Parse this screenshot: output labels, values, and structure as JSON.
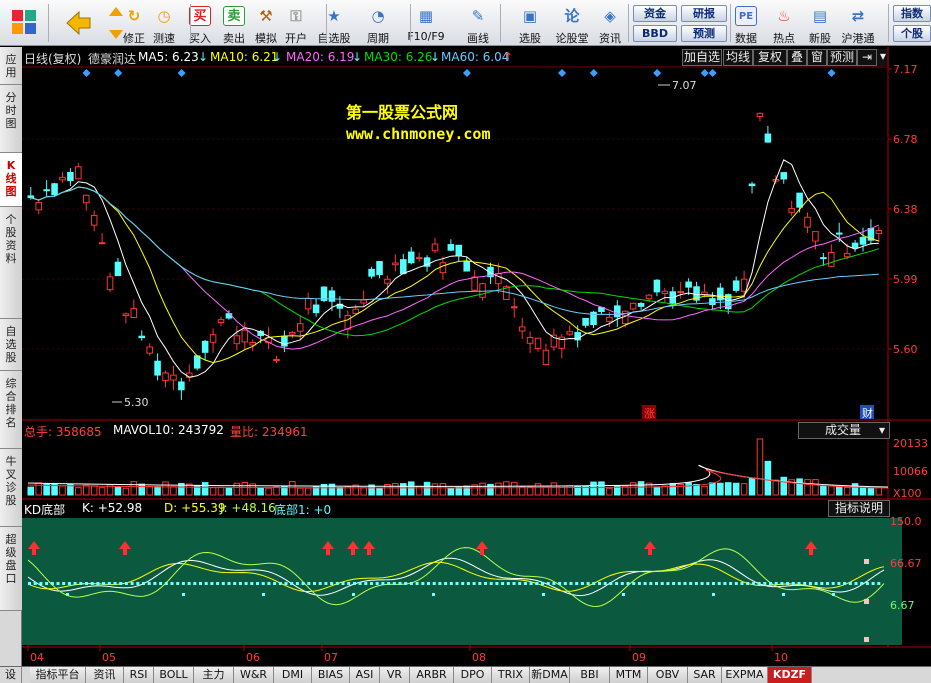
{
  "toolbar": {
    "items": [
      {
        "label": "修正",
        "icon": "refresh-icon"
      },
      {
        "label": "测速",
        "icon": "clock-icon"
      },
      {
        "label": "买入",
        "icon": "buy-icon",
        "glyph": "买"
      },
      {
        "label": "卖出",
        "icon": "sell-icon",
        "glyph": "卖"
      },
      {
        "label": "模拟",
        "icon": "hammer-icon"
      },
      {
        "label": "开户",
        "icon": "lock-icon"
      },
      {
        "label": "自选股",
        "icon": "star-icon"
      },
      {
        "label": "周期",
        "icon": "period-icon"
      },
      {
        "label": "F10/F9",
        "icon": "f10-icon"
      },
      {
        "label": "画线",
        "icon": "pencil-icon"
      },
      {
        "label": "选股",
        "icon": "select-stock-icon"
      },
      {
        "label": "论股堂",
        "icon": "forum-icon",
        "glyph": "论"
      },
      {
        "label": "资讯",
        "icon": "news-icon"
      },
      {
        "label": "数据",
        "icon": "data-icon",
        "glyph": "PE"
      },
      {
        "label": "热点",
        "icon": "hot-icon"
      },
      {
        "label": "新股",
        "icon": "new-stock-icon"
      },
      {
        "label": "沪港通",
        "icon": "shhk-icon"
      }
    ],
    "pills": [
      "资金",
      "研报",
      "BBD",
      "预测"
    ],
    "right_pills": [
      "指数",
      "个股"
    ]
  },
  "left_tabs": [
    "应用",
    "分时图",
    "K线图",
    "个股资料",
    "自选股",
    "综合排名",
    "牛叉诊股",
    "超级盘口"
  ],
  "left_tab_active": "K线图",
  "header": {
    "title": "日线(复权)",
    "stock_name": "德豪润达",
    "ma": [
      {
        "label": "MA5: 6.23",
        "color": "#ffffff"
      },
      {
        "label": "MA10: 6.21",
        "color": "#ffff00"
      },
      {
        "label": "MA20: 6.19",
        "color": "#ff66ff"
      },
      {
        "label": "MA30: 6.26",
        "color": "#00dd00"
      },
      {
        "label": "MA60: 6.04",
        "color": "#66ccff"
      }
    ],
    "buttons": [
      "加自选",
      "均线",
      "复权",
      "叠",
      "窗",
      "预测"
    ]
  },
  "watermark": {
    "line1": "第一股票公式网",
    "line2": "www.chnmoney.com"
  },
  "price_axis": [
    "7.17",
    "6.78",
    "6.38",
    "5.99",
    "5.60"
  ],
  "annotations": {
    "high": "7.07",
    "low": "5.30",
    "zhang": "涨",
    "cai": "财"
  },
  "volume": {
    "total": "总手: 358685",
    "mavol": "MAVOL10: 243792",
    "ratio": "量比: 234961",
    "dropdown": "成交量",
    "axis": [
      "20133",
      "10066",
      "X100"
    ]
  },
  "kd": {
    "title": "KD底部",
    "k": "K: +52.98",
    "d": "D: +55.39",
    "j": "J: +48.16",
    "bottom": "底部1: +0",
    "button": "指标说明",
    "axis": [
      "150.0",
      "66.67",
      "6.67"
    ]
  },
  "months": [
    "04",
    "05",
    "06",
    "07",
    "08",
    "09",
    "10"
  ],
  "bottom_tabs": [
    "设置",
    "指标平台",
    "资讯",
    "RSI",
    "BOLL",
    "主力",
    "W&R",
    "DMI",
    "BIAS",
    "ASI",
    "VR",
    "ARBR",
    "DPO",
    "TRIX",
    "新DMA",
    "BBI",
    "MTM",
    "OBV",
    "SAR",
    "EXPMA",
    "KDZF"
  ],
  "bottom_tab_active": "KDZF",
  "colors": {
    "up": "#ff3333",
    "down": "#54ffff",
    "kd_bg": "#0b5a40",
    "axis_text": "#ff3b3b"
  }
}
